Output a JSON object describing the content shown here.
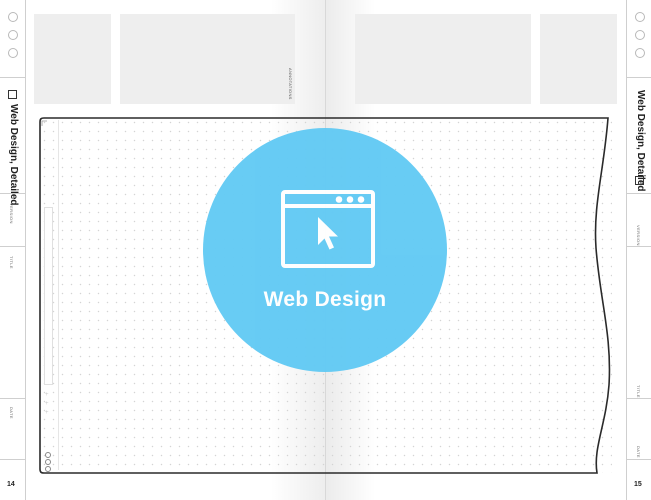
{
  "notebook": {
    "title": "Web Design, Detailed",
    "left_page_number": "14",
    "right_page_number": "15",
    "fields": {
      "version": "VERSION",
      "title": "TITLE",
      "date": "DATE"
    },
    "annotations_label": "ANNOTATIONS"
  },
  "badge": {
    "label": "Web Design",
    "icon": "browser-cursor-icon",
    "color": "#63caf4"
  },
  "colors": {
    "header_box": "#eeeeee",
    "frame_stroke": "#2a2a2a",
    "dot_grid": "#d4d4d4"
  }
}
